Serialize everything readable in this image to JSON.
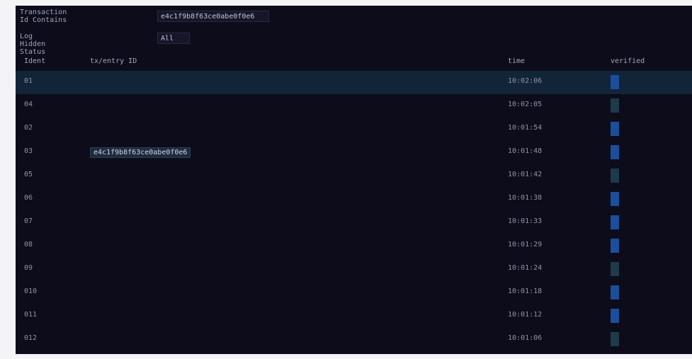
{
  "filters": {
    "row1": {
      "label": "Transaction Id   Contains",
      "value": "e4c1f9b8f63ce0abe0f0e6"
    },
    "row2": {
      "label": "Log Hidden   Status",
      "value": "All"
    }
  },
  "table": {
    "headers": {
      "id": "Ident",
      "tx": "tx/entry ID",
      "time": "time",
      "toggle": "verified"
    },
    "rows": [
      {
        "id": "01",
        "tx": "",
        "time": "10:02:06",
        "toggle": "on",
        "selected": true
      },
      {
        "id": "04",
        "tx": "",
        "time": "10:02:05",
        "toggle": "off",
        "selected": false
      },
      {
        "id": "02",
        "tx": "",
        "time": "10:01:54",
        "toggle": "on",
        "selected": false
      },
      {
        "id": "03",
        "tx": "e4c1f9b8f63ce0abe0f0e6",
        "time": "10:01:48",
        "toggle": "on",
        "selected": false
      },
      {
        "id": "05",
        "tx": "",
        "time": "10:01:42",
        "toggle": "off",
        "selected": false
      },
      {
        "id": "06",
        "tx": "",
        "time": "10:01:38",
        "toggle": "on",
        "selected": false
      },
      {
        "id": "07",
        "tx": "",
        "time": "10:01:33",
        "toggle": "on",
        "selected": false
      },
      {
        "id": "08",
        "tx": "",
        "time": "10:01:29",
        "toggle": "on",
        "selected": false
      },
      {
        "id": "09",
        "tx": "",
        "time": "10:01:24",
        "toggle": "off",
        "selected": false
      },
      {
        "id": "010",
        "tx": "",
        "time": "10:01:18",
        "toggle": "on",
        "selected": false
      },
      {
        "id": "011",
        "tx": "",
        "time": "10:01:12",
        "toggle": "on",
        "selected": false
      },
      {
        "id": "012",
        "tx": "",
        "time": "10:01:06",
        "toggle": "off",
        "selected": false
      }
    ]
  }
}
